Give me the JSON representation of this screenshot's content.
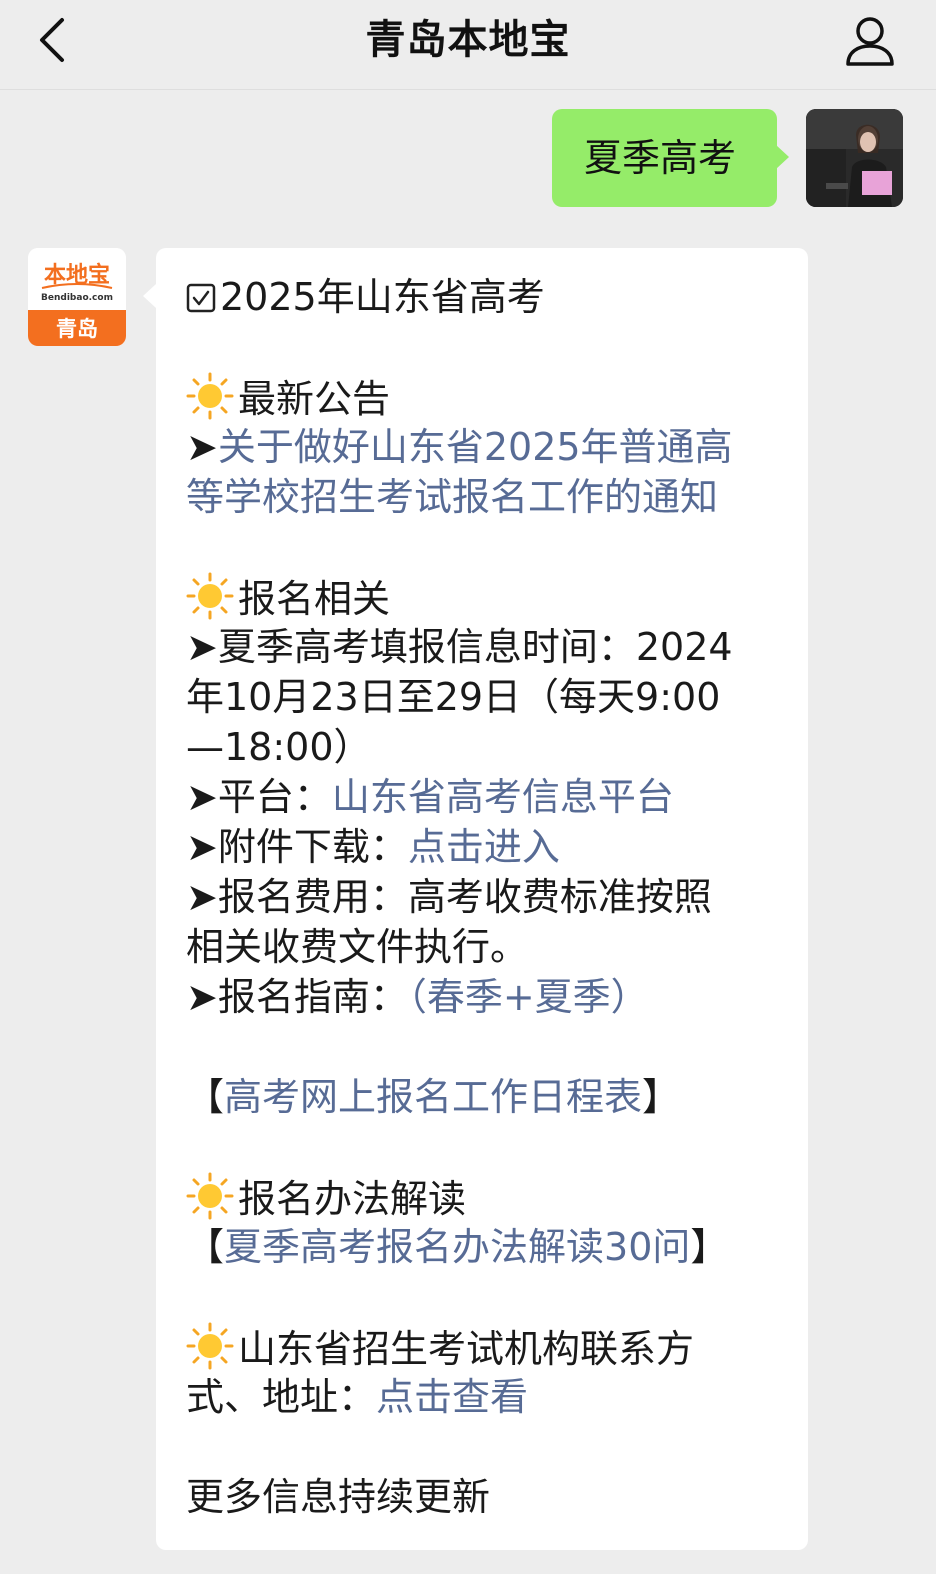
{
  "header": {
    "title": "青岛本地宝",
    "back_icon": "chevron-left-icon",
    "profile_icon": "person-icon"
  },
  "colors": {
    "background": "#ededed",
    "outgoing_bubble": "#95ec69",
    "link": "#576b95",
    "brand_orange": "#f36f1f"
  },
  "outgoing": {
    "text": "夏季高考"
  },
  "bot": {
    "avatar_text_top": "本地宝",
    "avatar_text_url": "Bendibao.com",
    "avatar_text_city": "青岛"
  },
  "message": {
    "heading": "2025年山东省高考",
    "section1_title": "最新公告",
    "s1_arrow": "➤",
    "s1_link_line1": "关于做好山东省2025年普通高",
    "s1_link_line2": "等学校招生考试报名工作的通知",
    "section2_title": "报名相关",
    "s2_time_line1": "➤夏季高考填报信息时间：2024",
    "s2_time_line2": "年10月23日至29日（每天9:00",
    "s2_time_line3": "—18:00）",
    "s2_platform_label": "➤平台：",
    "s2_platform_link": "山东省高考信息平台",
    "s2_attach_label": "➤附件下载：",
    "s2_attach_link": "点击进入",
    "s2_fee_line1": "➤报名费用：高考收费标准按照",
    "s2_fee_line2": "相关收费文件执行。",
    "s2_guide_label": "➤报名指南：",
    "s2_guide_link": "（春季+夏季）",
    "schedule_open": "【",
    "schedule_link": "高考网上报名工作日程表",
    "schedule_close": "】",
    "section3_title": "报名办法解读",
    "s3_open": "【",
    "s3_link": "夏季高考报名办法解读30问",
    "s3_close": "】",
    "section4_title_line1": "山东省招生考试机构联系方",
    "section4_title_line2_label": "式、地址：",
    "section4_link": "点击查看",
    "footer": "更多信息持续更新"
  }
}
